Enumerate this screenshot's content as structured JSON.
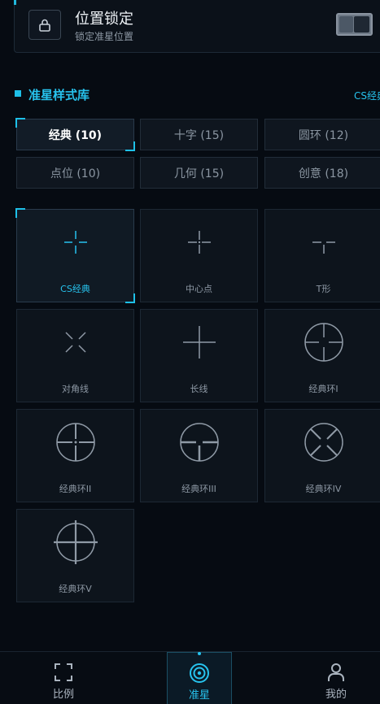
{
  "lock": {
    "title": "位置锁定",
    "subtitle": "锁定准星位置",
    "enabled": false
  },
  "section": {
    "title": "准星样式库",
    "link": "CS经典"
  },
  "tabs": [
    {
      "label": "经典 (10)",
      "active": true
    },
    {
      "label": "十字 (15)",
      "active": false
    },
    {
      "label": "圆环 (12)",
      "active": false
    },
    {
      "label": "点位 (10)",
      "active": false
    },
    {
      "label": "几何 (15)",
      "active": false
    },
    {
      "label": "创意 (18)",
      "active": false
    }
  ],
  "styles": [
    {
      "label": "CS经典",
      "icon": "cs-classic-crosshair-icon",
      "active": true
    },
    {
      "label": "中心点",
      "icon": "center-dot-crosshair-icon",
      "active": false
    },
    {
      "label": "T形",
      "icon": "t-shape-crosshair-icon",
      "active": false
    },
    {
      "label": "对角线",
      "icon": "diagonal-crosshair-icon",
      "active": false
    },
    {
      "label": "长线",
      "icon": "long-line-crosshair-icon",
      "active": false
    },
    {
      "label": "经典环I",
      "icon": "classic-ring-1-icon",
      "active": false
    },
    {
      "label": "经典环II",
      "icon": "classic-ring-2-icon",
      "active": false
    },
    {
      "label": "经典环III",
      "icon": "classic-ring-3-icon",
      "active": false
    },
    {
      "label": "经典环IV",
      "icon": "classic-ring-4-icon",
      "active": false
    },
    {
      "label": "经典环V",
      "icon": "classic-ring-5-icon",
      "active": false
    }
  ],
  "nav": [
    {
      "label": "比例",
      "icon": "scan-frame-icon",
      "active": false
    },
    {
      "label": "准星",
      "icon": "target-icon",
      "active": true
    },
    {
      "label": "我的",
      "icon": "user-icon",
      "active": false
    }
  ],
  "colors": {
    "accent": "#27c3ee",
    "background": "#060b12",
    "card": "#0d141c",
    "glyph": "#8f9aa6"
  }
}
